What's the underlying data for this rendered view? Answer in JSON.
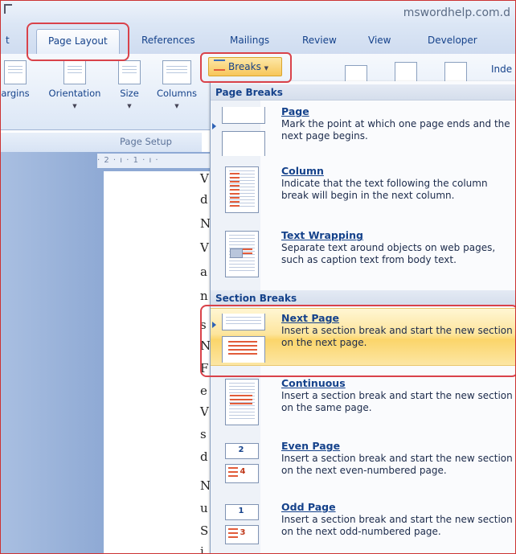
{
  "window": {
    "site": "mswordhelp.com.d"
  },
  "tabs": [
    {
      "label": "t"
    },
    {
      "label": "Page Layout"
    },
    {
      "label": "References"
    },
    {
      "label": "Mailings"
    },
    {
      "label": "Review"
    },
    {
      "label": "View"
    },
    {
      "label": "Developer"
    }
  ],
  "ribbon": {
    "buttons": [
      {
        "label": "argins"
      },
      {
        "label": "Orientation"
      },
      {
        "label": "Size"
      },
      {
        "label": "Columns"
      }
    ],
    "breaks_label": "Breaks",
    "group_label": "Page Setup",
    "indent_label": "Inde"
  },
  "ruler": {
    "text": "· 2 · ı · 1 · ı ·"
  },
  "doc_letters": [
    "V",
    "d",
    "N",
    "V",
    "a",
    "n",
    "s",
    "N",
    "F",
    "e",
    "V",
    "s",
    "d",
    "N",
    "u",
    "S",
    "i"
  ],
  "menu": {
    "page_breaks_header": "Page Breaks",
    "section_breaks_header": "Section Breaks",
    "items": [
      {
        "title": "Page",
        "desc": "Mark the point at which one page ends and the next page begins.",
        "icon": "page-break-icon"
      },
      {
        "title": "Column",
        "desc": "Indicate that the text following the column break will begin in the next column.",
        "icon": "column-break-icon"
      },
      {
        "title": "Text Wrapping",
        "desc": "Separate text around objects on web pages, such as caption text from body text.",
        "icon": "text-wrapping-icon"
      },
      {
        "title": "Next Page",
        "desc": "Insert a section break and start the new section on the next page.",
        "icon": "next-page-icon"
      },
      {
        "title": "Continuous",
        "desc": "Insert a section break and start the new section on the same page.",
        "icon": "continuous-icon"
      },
      {
        "title": "Even Page",
        "desc": "Insert a section break and start the new section on the next even-numbered page.",
        "icon": "even-page-icon",
        "nums": [
          "2",
          "4"
        ]
      },
      {
        "title": "Odd Page",
        "desc": "Insert a section break and start the new section on the next odd-numbered page.",
        "icon": "odd-page-icon",
        "nums": [
          "1",
          "3"
        ]
      }
    ]
  },
  "colors": {
    "accent": "#15428b",
    "highlight": "#fbd56a",
    "callout": "#d9424a"
  }
}
